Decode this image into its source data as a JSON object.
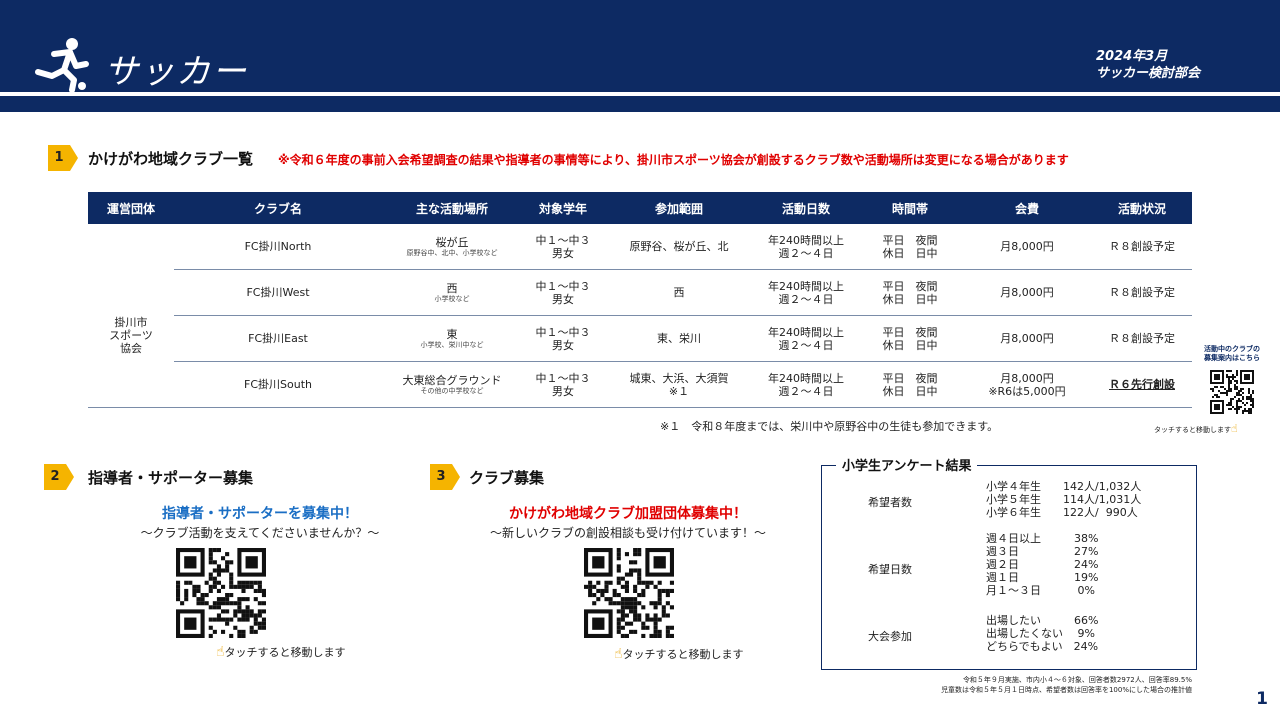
{
  "header": {
    "title": "サッカー",
    "date": "2024年3月",
    "org": "サッカー検討部会",
    "icon": "runner-icon"
  },
  "section1": {
    "number": "1",
    "title": "かけがわ地域クラブ一覧",
    "note": "※令和６年度の事前入会希望調査の結果や指導者の事情等により、掛川市スポーツ協会が創設するクラブ数や活動場所は変更になる場合があります",
    "columns": [
      "運営団体",
      "クラブ名",
      "主な活動場所",
      "対象学年",
      "参加範囲",
      "活動日数",
      "時間帯",
      "会費",
      "活動状況"
    ],
    "org_cell": [
      "掛川市",
      "スポーツ",
      "協会"
    ],
    "rows": [
      {
        "club": "FC掛川North",
        "place": "桜が丘",
        "place_sub": "原野谷中、北中、小学校など",
        "grade1": "中１～中３",
        "grade2": "男女",
        "range1": "原野谷、桜が丘、北",
        "range2": "",
        "days1": "年240時間以上",
        "days2": "週２～４日",
        "time1": "平日　夜間",
        "time2": "休日　日中",
        "fee1": "月8,000円",
        "fee2": "",
        "status": "Ｒ８創設予定"
      },
      {
        "club": "FC掛川West",
        "place": "西",
        "place_sub": "小学校など",
        "grade1": "中１～中３",
        "grade2": "男女",
        "range1": "西",
        "range2": "",
        "days1": "年240時間以上",
        "days2": "週２～４日",
        "time1": "平日　夜間",
        "time2": "休日　日中",
        "fee1": "月8,000円",
        "fee2": "",
        "status": "Ｒ８創設予定"
      },
      {
        "club": "FC掛川East",
        "place": "東",
        "place_sub": "小学校、栄川中など",
        "grade1": "中１～中３",
        "grade2": "男女",
        "range1": "東、栄川",
        "range2": "",
        "days1": "年240時間以上",
        "days2": "週２～４日",
        "time1": "平日　夜間",
        "time2": "休日　日中",
        "fee1": "月8,000円",
        "fee2": "",
        "status": "Ｒ８創設予定"
      },
      {
        "club": "FC掛川South",
        "place": "大東総合グラウンド",
        "place_sub": "その他の中学校など",
        "grade1": "中１～中３",
        "grade2": "男女",
        "range1": "城東、大浜、大須賀",
        "range2": "※１",
        "days1": "年240時間以上",
        "days2": "週２～４日",
        "time1": "平日　夜間",
        "time2": "休日　日中",
        "fee1": "月8,000円",
        "fee2": "※R6は5,000円",
        "status": "Ｒ６先行創設"
      }
    ],
    "footnote": "※１　令和８年度までは、栄川中や原野谷中の生徒も参加できます。",
    "side_qr_label1": "活動中のクラブの",
    "side_qr_label2": "募集案内はこちら",
    "side_touch": "タッチすると移動します"
  },
  "section2": {
    "number": "2",
    "title": "指導者・サポーター募集",
    "headline": "指導者・サポーターを募集中！",
    "sub": "～クラブ活動を支えてくださいませんか？～",
    "touch": "タッチすると移動します"
  },
  "section3": {
    "number": "3",
    "title": "クラブ募集",
    "headline": "かけがわ地域クラブ加盟団体募集中！",
    "sub": "～新しいクラブの創設相談も受け付けています！～",
    "touch": "タッチすると移動します"
  },
  "survey": {
    "title": "小学生アンケート結果",
    "groups": [
      {
        "label": "希望者数",
        "rows": [
          "小学４年生　　142人/1,032人",
          "小学５年生　　114人/1,031人",
          "小学６年生　　122人/  990人"
        ]
      },
      {
        "label": "希望日数",
        "rows": [
          "週４日以上　　　38%",
          "週３日　　　　　27%",
          "週２日　　　　　24%",
          "週１日　　　　　19%",
          "月１～３日　　　 0%"
        ]
      },
      {
        "label": "大会参加",
        "rows": [
          "出場したい　　　66%",
          "出場したくない　 9%",
          "どちらでもよい　24%"
        ]
      }
    ],
    "fine1": "令和５年９月実施、市内小４～６対象、回答者数2972人、回答率89.5%",
    "fine2": "児童数は令和５年５月１日時点、希望者数は回答率を100%にした場合の推計値"
  },
  "page_number": "1",
  "colors": {
    "navy": "#0d2a63",
    "badge": "#f5b400",
    "red": "#e00000",
    "blue": "#1a6ec4"
  }
}
